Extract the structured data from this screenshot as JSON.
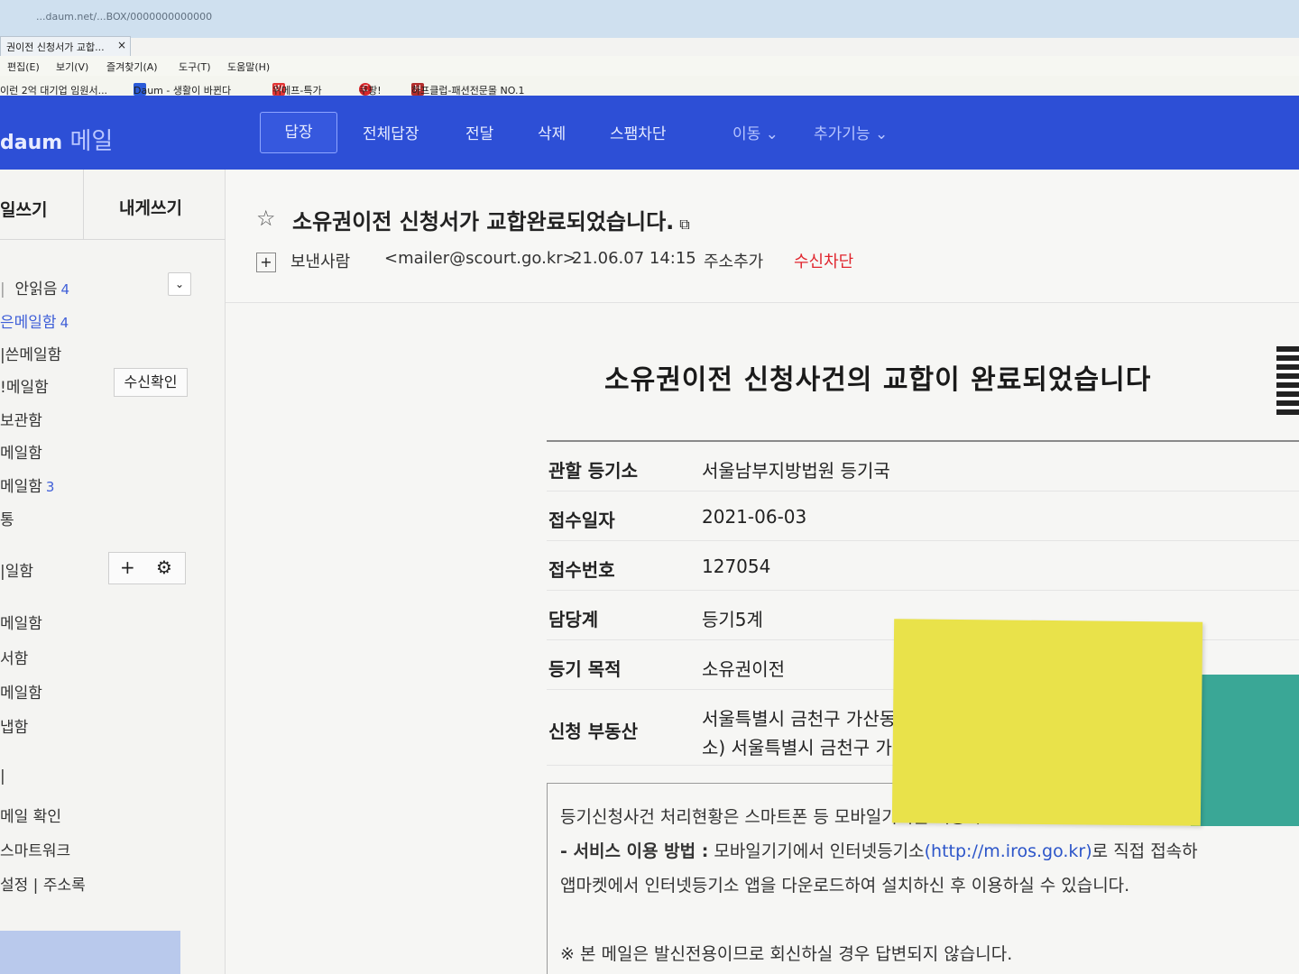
{
  "browser": {
    "tab_title": "권이전 신청서가 교합...",
    "tab_close": "×",
    "address": "...daum.net/...BOX/0000000000000",
    "menu": [
      "편집(E)",
      "보기(V)",
      "즐겨찾기(A)",
      "도구(T)",
      "도움말(H)"
    ],
    "favorites": [
      {
        "label": "이런 2억 대기업 임원서...",
        "icon": ""
      },
      {
        "label": "Daum - 생활이 바뀐다",
        "icon": "daum"
      },
      {
        "label": "위메프-특가",
        "icon": "W"
      },
      {
        "label": "쿠팡!",
        "icon": "C"
      },
      {
        "label": "하프클럽-패션전문몰 NO.1",
        "icon": "H"
      }
    ]
  },
  "mail_header": {
    "logo_brand": "daum",
    "logo_text": "메일",
    "toolbar": {
      "reply": "답장",
      "reply_all": "전체답장",
      "forward": "전달",
      "delete": "삭제",
      "spam": "스팸차단",
      "move": "이동 ⌄",
      "more": "추가기능 ⌄"
    }
  },
  "sidebar": {
    "compose": "일쓰기",
    "self_compose": "내게쓰기",
    "unread_label": "안읽음",
    "unread_count": "4",
    "items": [
      {
        "label": "은메일함",
        "count": "4"
      },
      {
        "label": "|쓴메일함",
        "count": ""
      },
      {
        "label": "!메일함",
        "count": ""
      },
      {
        "label": "보관함",
        "count": ""
      },
      {
        "label": "메일함",
        "count": ""
      },
      {
        "label": "메일함",
        "count": "3"
      },
      {
        "label": "통",
        "count": ""
      },
      {
        "label": "|일함",
        "count": ""
      },
      {
        "label": "메일함",
        "count": ""
      },
      {
        "label": "서함",
        "count": ""
      },
      {
        "label": "메일함",
        "count": ""
      },
      {
        "label": "냅함",
        "count": ""
      },
      {
        "label": "|",
        "count": ""
      },
      {
        "label": "메일 확인",
        "count": ""
      },
      {
        "label": "스마트워크",
        "count": ""
      },
      {
        "label": "설정  |  주소록",
        "count": ""
      }
    ],
    "receipt_button": "수신확인",
    "add": "+",
    "settings": "⚙"
  },
  "message": {
    "subject": "소유권이전 신청서가 교합완료되었습니다.",
    "sender_label": "보낸사람",
    "sender_email": "<mailer@scourt.go.kr>",
    "date": "21.06.07 14:15",
    "add_contact": "주소추가",
    "block": "수신차단"
  },
  "body": {
    "title": "소유권이전 신청사건의 교합이 완료되었습니다",
    "rows": [
      {
        "label": "관할 등기소",
        "value": "서울남부지방법원 등기국"
      },
      {
        "label": "접수일자",
        "value": "2021-06-03"
      },
      {
        "label": "접수번호",
        "value": "127054"
      },
      {
        "label": "담당계",
        "value": "등기5계"
      },
      {
        "label": "등기 목적",
        "value": "소유권이전"
      }
    ],
    "property_label": "신청 부동산",
    "property_line1": "서울특별시 금천구 가산동",
    "property_line2": "소) 서울특별시 금천구 가산",
    "notice_line1": "등기신청사건 처리현황은 스마트폰 등 모바일기기를 이용하",
    "notice_service_label": "- 서비스 이용 방법 :",
    "notice_line2_a": " 모바일기기에서 인터넷등기소",
    "notice_link": "(http://m.iros.go.kr)",
    "notice_line2_b": "로 직접 접속하",
    "notice_line3": "앱마켓에서 인터넷등기소 앱을 다운로드하여 설치하신 후 이용하실 수 있습니다.",
    "notice_footer": "※ 본 메일은 발신전용이므로 회신하실 경우 답변되지 않습니다."
  }
}
